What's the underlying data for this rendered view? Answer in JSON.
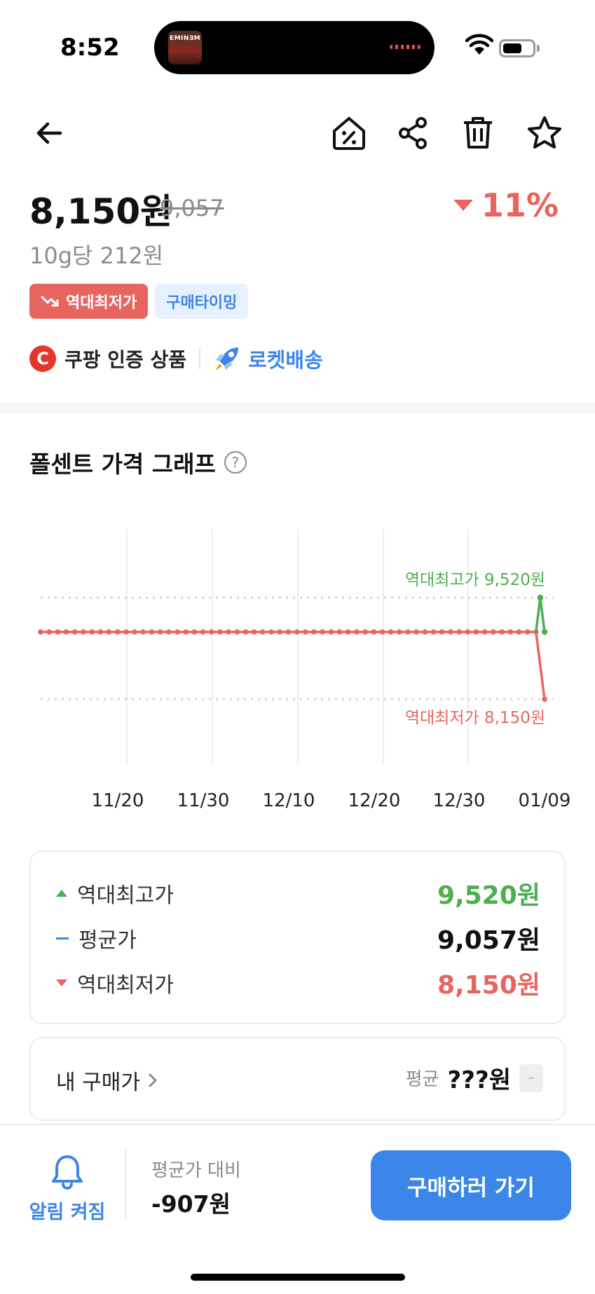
{
  "status_bar": {
    "time": "8:52",
    "album_art_text": "EMINƎM",
    "icons": [
      "wifi-icon",
      "battery-icon"
    ]
  },
  "nav": {
    "icons": [
      "back-arrow-icon",
      "price-tag-percent-icon",
      "share-icon",
      "trash-icon",
      "star-icon"
    ]
  },
  "product": {
    "price": "8,150원",
    "original_price": "9,057",
    "discount": "11%",
    "unit_price": "10g당 212원",
    "tags": [
      "역대최저가",
      "구매타이밍"
    ],
    "seller": "쿠팡 인증 상품",
    "delivery": "로켓배송"
  },
  "graph": {
    "title": "폴센트 가격 그래프"
  },
  "chart_data": {
    "type": "line",
    "x_tick_labels": [
      "11/20",
      "11/30",
      "12/10",
      "12/20",
      "12/30",
      "01/09"
    ],
    "x_range": [
      "11/11",
      "01/09"
    ],
    "grid": "vertical",
    "reference_lines": [
      {
        "label": "역대최고가 9,520원",
        "value": 9520,
        "color": "#4caf50",
        "style": "dotted"
      },
      {
        "label": "역대최저가 8,150원",
        "value": 8150,
        "color": "#e8655f",
        "style": "dotted"
      }
    ],
    "series": [
      {
        "color": "#e8655f",
        "values": [
          9057,
          9057,
          9057,
          9057,
          9057,
          9057,
          9057,
          9057,
          9057,
          9057,
          9057,
          9057,
          9057,
          9057,
          9057,
          9057,
          9057,
          9057,
          9057,
          9057,
          9057,
          9057,
          9057,
          9057,
          9057,
          9057,
          9057,
          9057,
          9057,
          9057,
          9057,
          9057,
          9057,
          9057,
          9057,
          9057,
          9057,
          9057,
          9057,
          9057,
          9057,
          9057,
          9057,
          9057,
          9057,
          9057,
          9057,
          9057,
          9057,
          9057,
          9057,
          9057,
          9057,
          9057,
          9057,
          9057,
          9057,
          9057,
          9057,
          8150
        ]
      },
      {
        "color": "#4caf50",
        "values": [
          9057,
          9520,
          9057
        ]
      }
    ]
  },
  "summary": {
    "rows": [
      {
        "label": "역대최고가",
        "value": "9,520원",
        "color": "#4caf50"
      },
      {
        "label": "평균가",
        "value": "9,057원",
        "color": "#111111"
      },
      {
        "label": "역대최저가",
        "value": "8,150원",
        "color": "#e8655f"
      }
    ]
  },
  "my_purchase": {
    "label": "내 구매가",
    "avg_label": "평균",
    "avg_value": "???원",
    "badge": "–"
  },
  "bottom_bar": {
    "alarm_label": "알림 켜짐",
    "vs_label": "평균가 대비",
    "vs_value": "-907원",
    "buy_label": "구매하러 가기"
  },
  "colors": {
    "accent_blue": "#3b86e8",
    "price_red": "#e8655f",
    "high_green": "#4caf50"
  }
}
